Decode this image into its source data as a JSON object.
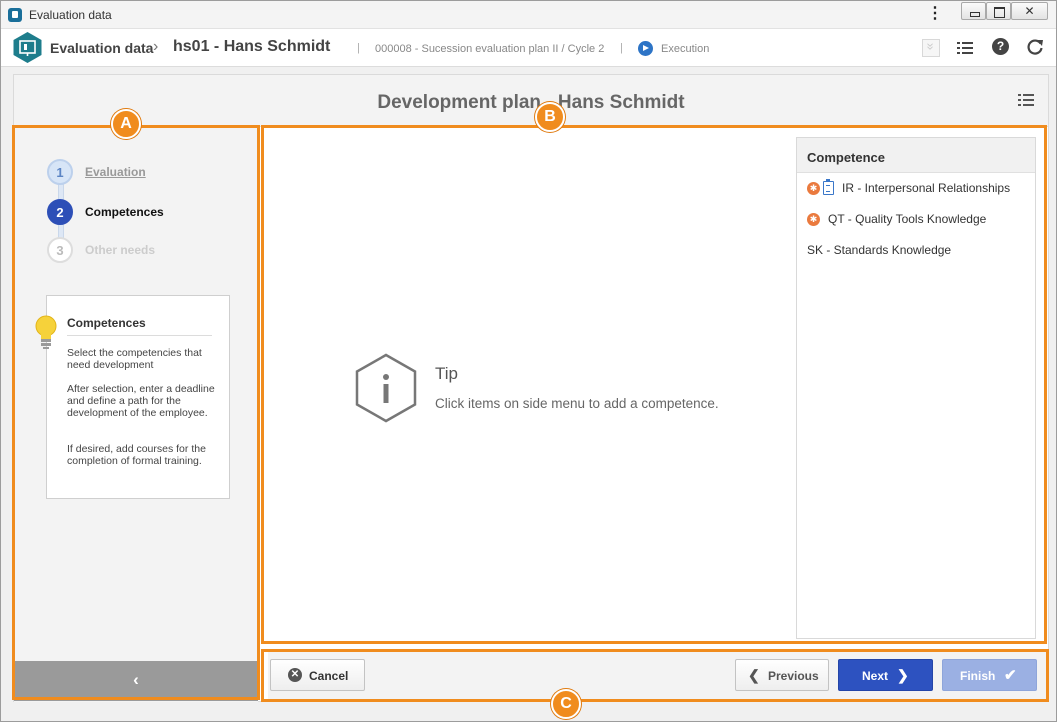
{
  "window": {
    "title": "Evaluation data"
  },
  "header": {
    "breadcrumb_root": "Evaluation data",
    "breadcrumb_separator": "›",
    "record": "hs01 - Hans Schmidt",
    "plan": "000008 - Sucession evaluation plan II / Cycle 2",
    "status": "Execution",
    "pipe": "|"
  },
  "panel": {
    "title": "Development plan - Hans Schmidt"
  },
  "steps": [
    {
      "number": "1",
      "label": "Evaluation"
    },
    {
      "number": "2",
      "label": "Competences"
    },
    {
      "number": "3",
      "label": "Other needs"
    }
  ],
  "info": {
    "title": "Competences",
    "paragraphs": [
      "Select the competencies that need development",
      "After selection, enter a deadline and define a path for the development of the employee.",
      "If desired, add courses for the completion of formal training."
    ]
  },
  "tip": {
    "title": "Tip",
    "text": "Click items on side menu to add a competence."
  },
  "competence": {
    "header": "Competence",
    "items": [
      {
        "label": "IR - Interpersonal Relationships"
      },
      {
        "label": "QT - Quality Tools Knowledge"
      },
      {
        "label": "SK - Standards Knowledge"
      }
    ]
  },
  "footer": {
    "cancel": "Cancel",
    "previous": "Previous",
    "next": "Next",
    "finish": "Finish"
  },
  "annotations": {
    "a": "A",
    "b": "B",
    "c": "C"
  },
  "colors": {
    "accent_blue": "#2d52c0",
    "annotation_orange": "#f08c1e",
    "logo_teal": "#1e7d8c",
    "competence_icon": "#ea7a3e"
  }
}
